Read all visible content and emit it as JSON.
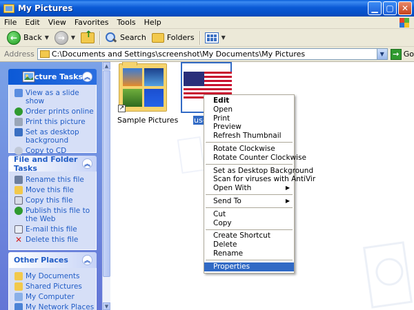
{
  "window": {
    "title": "My Pictures"
  },
  "menubar": [
    "File",
    "Edit",
    "View",
    "Favorites",
    "Tools",
    "Help"
  ],
  "toolbar": {
    "back": "Back",
    "search": "Search",
    "folders": "Folders"
  },
  "address": {
    "label": "Address",
    "path": "C:\\Documents and Settings\\screenshot\\My Documents\\My Pictures",
    "go": "Go"
  },
  "taskpane": {
    "picture_tasks": {
      "title": "Picture Tasks",
      "items": [
        "View as a slide show",
        "Order prints online",
        "Print this picture",
        "Set as desktop background",
        "Copy to CD"
      ]
    },
    "file_tasks": {
      "title": "File and Folder Tasks",
      "items": [
        "Rename this file",
        "Move this file",
        "Copy this file",
        "Publish this file to the Web",
        "E-mail this file",
        "Delete this file"
      ]
    },
    "other_places": {
      "title": "Other Places",
      "items": [
        "My Documents",
        "Shared Pictures",
        "My Computer",
        "My Network Places"
      ]
    }
  },
  "files": [
    {
      "name": "Sample Pictures"
    },
    {
      "name": "us-"
    }
  ],
  "context_menu": {
    "g1": [
      "Edit",
      "Open",
      "Print",
      "Preview",
      "Refresh Thumbnail"
    ],
    "g2": [
      "Rotate Clockwise",
      "Rotate Counter Clockwise"
    ],
    "g3": [
      "Set as Desktop Background",
      "Scan for viruses with AntiVir",
      "Open With"
    ],
    "g4": [
      "Send To"
    ],
    "g5": [
      "Cut",
      "Copy"
    ],
    "g6": [
      "Create Shortcut",
      "Delete",
      "Rename"
    ],
    "g7": [
      "Properties"
    ]
  },
  "colors": {
    "selection": "#316ac5",
    "taskpane_link": "#215dc6",
    "titlebar": "#0b5ad6"
  }
}
